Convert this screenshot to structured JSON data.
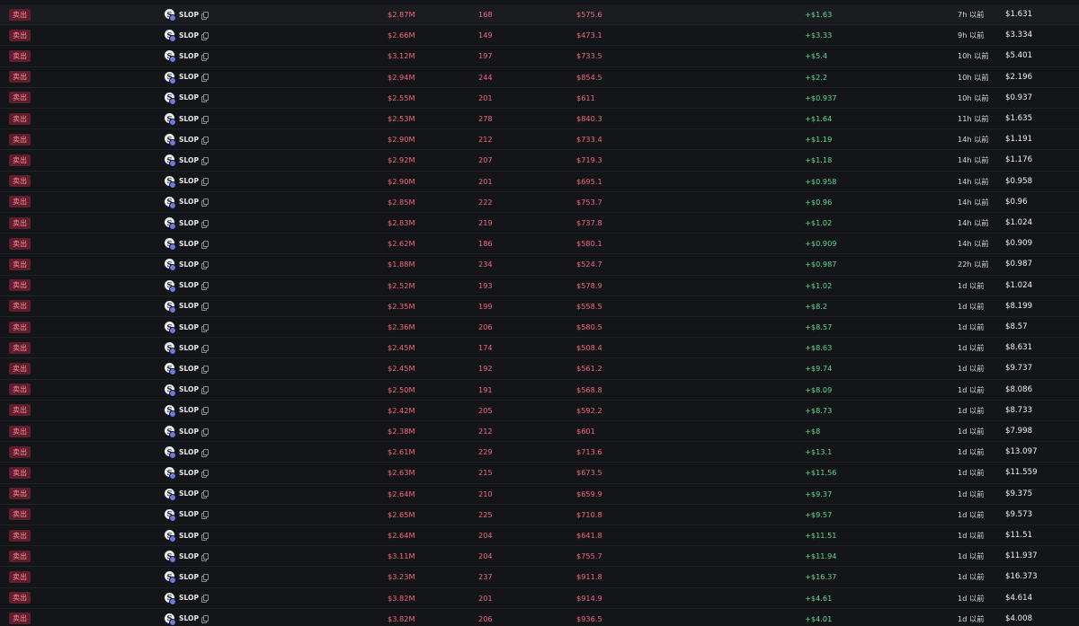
{
  "colors": {
    "background": "#141518",
    "sell_badge_bg": "#5e1e2b",
    "sell_badge_text": "#ff8b9c",
    "negative": "#f2687a",
    "positive": "#5cd98d",
    "chain_badge": "#6b78e8"
  },
  "icons": {
    "token": "slop-token-logo",
    "chain": "chain-badge-icon",
    "copy": "copy-icon"
  },
  "rows": [
    {
      "type": "卖出",
      "token": "SLOP",
      "mcap": "$2.87M",
      "amount": "168",
      "value": "$575.6",
      "pnl": "+$1.63",
      "time": "7h 以前",
      "price": "$1.631"
    },
    {
      "type": "卖出",
      "token": "SLOP",
      "mcap": "$2.66M",
      "amount": "149",
      "value": "$473.1",
      "pnl": "+$3.33",
      "time": "9h 以前",
      "price": "$3.334"
    },
    {
      "type": "卖出",
      "token": "SLOP",
      "mcap": "$3.12M",
      "amount": "197",
      "value": "$733.5",
      "pnl": "+$5.4",
      "time": "10h 以前",
      "price": "$5.401"
    },
    {
      "type": "卖出",
      "token": "SLOP",
      "mcap": "$2.94M",
      "amount": "244",
      "value": "$854.5",
      "pnl": "+$2.2",
      "time": "10h 以前",
      "price": "$2.196"
    },
    {
      "type": "卖出",
      "token": "SLOP",
      "mcap": "$2.55M",
      "amount": "201",
      "value": "$611",
      "pnl": "+$0.937",
      "time": "10h 以前",
      "price": "$0.937"
    },
    {
      "type": "卖出",
      "token": "SLOP",
      "mcap": "$2.53M",
      "amount": "278",
      "value": "$840.3",
      "pnl": "+$1.64",
      "time": "11h 以前",
      "price": "$1.635"
    },
    {
      "type": "卖出",
      "token": "SLOP",
      "mcap": "$2.90M",
      "amount": "212",
      "value": "$733.4",
      "pnl": "+$1.19",
      "time": "14h 以前",
      "price": "$1.191"
    },
    {
      "type": "卖出",
      "token": "SLOP",
      "mcap": "$2.92M",
      "amount": "207",
      "value": "$719.3",
      "pnl": "+$1.18",
      "time": "14h 以前",
      "price": "$1.176"
    },
    {
      "type": "卖出",
      "token": "SLOP",
      "mcap": "$2.90M",
      "amount": "201",
      "value": "$695.1",
      "pnl": "+$0.958",
      "time": "14h 以前",
      "price": "$0.958"
    },
    {
      "type": "卖出",
      "token": "SLOP",
      "mcap": "$2.85M",
      "amount": "222",
      "value": "$753.7",
      "pnl": "+$0.96",
      "time": "14h 以前",
      "price": "$0.96"
    },
    {
      "type": "卖出",
      "token": "SLOP",
      "mcap": "$2.83M",
      "amount": "219",
      "value": "$737.8",
      "pnl": "+$1.02",
      "time": "14h 以前",
      "price": "$1.024"
    },
    {
      "type": "卖出",
      "token": "SLOP",
      "mcap": "$2.62M",
      "amount": "186",
      "value": "$580.1",
      "pnl": "+$0.909",
      "time": "14h 以前",
      "price": "$0.909"
    },
    {
      "type": "卖出",
      "token": "SLOP",
      "mcap": "$1.88M",
      "amount": "234",
      "value": "$524.7",
      "pnl": "+$0.987",
      "time": "22h 以前",
      "price": "$0.987"
    },
    {
      "type": "卖出",
      "token": "SLOP",
      "mcap": "$2.52M",
      "amount": "193",
      "value": "$578.9",
      "pnl": "+$1.02",
      "time": "1d 以前",
      "price": "$1.024"
    },
    {
      "type": "卖出",
      "token": "SLOP",
      "mcap": "$2.35M",
      "amount": "199",
      "value": "$558.5",
      "pnl": "+$8.2",
      "time": "1d 以前",
      "price": "$8.199"
    },
    {
      "type": "卖出",
      "token": "SLOP",
      "mcap": "$2.36M",
      "amount": "206",
      "value": "$580.5",
      "pnl": "+$8.57",
      "time": "1d 以前",
      "price": "$8.57"
    },
    {
      "type": "卖出",
      "token": "SLOP",
      "mcap": "$2.45M",
      "amount": "174",
      "value": "$508.4",
      "pnl": "+$8.63",
      "time": "1d 以前",
      "price": "$8.631"
    },
    {
      "type": "卖出",
      "token": "SLOP",
      "mcap": "$2.45M",
      "amount": "192",
      "value": "$561.2",
      "pnl": "+$9.74",
      "time": "1d 以前",
      "price": "$9.737"
    },
    {
      "type": "卖出",
      "token": "SLOP",
      "mcap": "$2.50M",
      "amount": "191",
      "value": "$568.8",
      "pnl": "+$8.09",
      "time": "1d 以前",
      "price": "$8.086"
    },
    {
      "type": "卖出",
      "token": "SLOP",
      "mcap": "$2.42M",
      "amount": "205",
      "value": "$592.2",
      "pnl": "+$8.73",
      "time": "1d 以前",
      "price": "$8.733"
    },
    {
      "type": "卖出",
      "token": "SLOP",
      "mcap": "$2.38M",
      "amount": "212",
      "value": "$601",
      "pnl": "+$8",
      "time": "1d 以前",
      "price": "$7.998"
    },
    {
      "type": "卖出",
      "token": "SLOP",
      "mcap": "$2.61M",
      "amount": "229",
      "value": "$713.6",
      "pnl": "+$13.1",
      "time": "1d 以前",
      "price": "$13.097"
    },
    {
      "type": "卖出",
      "token": "SLOP",
      "mcap": "$2.63M",
      "amount": "215",
      "value": "$673.5",
      "pnl": "+$11.56",
      "time": "1d 以前",
      "price": "$11.559"
    },
    {
      "type": "卖出",
      "token": "SLOP",
      "mcap": "$2.64M",
      "amount": "210",
      "value": "$659.9",
      "pnl": "+$9.37",
      "time": "1d 以前",
      "price": "$9.375"
    },
    {
      "type": "卖出",
      "token": "SLOP",
      "mcap": "$2.65M",
      "amount": "225",
      "value": "$710.8",
      "pnl": "+$9.57",
      "time": "1d 以前",
      "price": "$9.573"
    },
    {
      "type": "卖出",
      "token": "SLOP",
      "mcap": "$2.64M",
      "amount": "204",
      "value": "$641.8",
      "pnl": "+$11.51",
      "time": "1d 以前",
      "price": "$11.51"
    },
    {
      "type": "卖出",
      "token": "SLOP",
      "mcap": "$3.11M",
      "amount": "204",
      "value": "$755.7",
      "pnl": "+$11.94",
      "time": "1d 以前",
      "price": "$11.937"
    },
    {
      "type": "卖出",
      "token": "SLOP",
      "mcap": "$3.23M",
      "amount": "237",
      "value": "$911.8",
      "pnl": "+$16.37",
      "time": "1d 以前",
      "price": "$16.373"
    },
    {
      "type": "卖出",
      "token": "SLOP",
      "mcap": "$3.82M",
      "amount": "201",
      "value": "$914.9",
      "pnl": "+$4.61",
      "time": "1d 以前",
      "price": "$4.614"
    },
    {
      "type": "卖出",
      "token": "SLOP",
      "mcap": "$3.82M",
      "amount": "206",
      "value": "$936.5",
      "pnl": "+$4.01",
      "time": "1d 以前",
      "price": "$4.008"
    }
  ]
}
